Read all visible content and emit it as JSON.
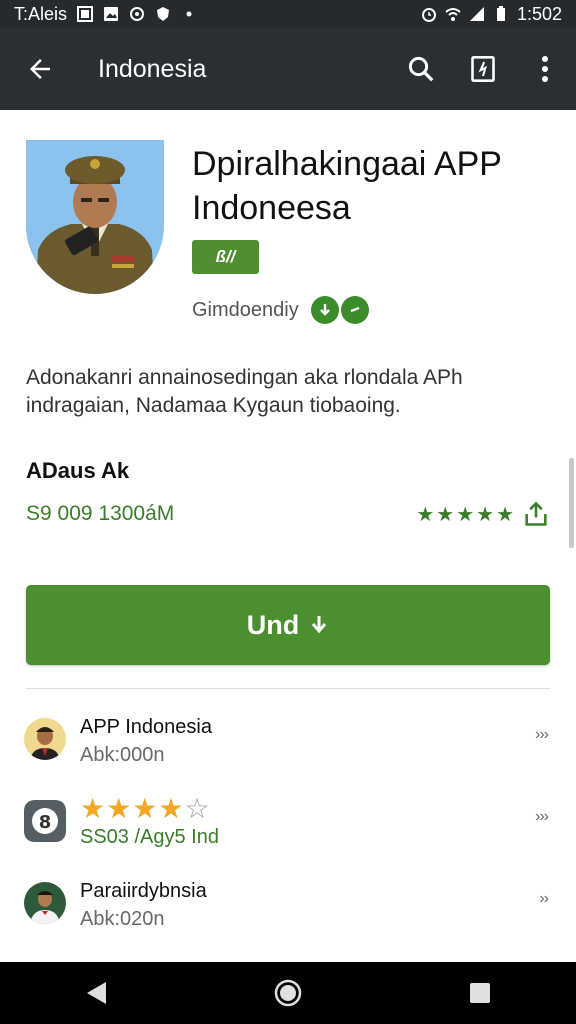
{
  "status_bar": {
    "carrier": "T:Aleis",
    "time": "1:502"
  },
  "app_bar": {
    "title": "Indonesia",
    "back_icon": "arrow-left-icon",
    "actions": [
      "search-icon",
      "bookmark-icon",
      "more-vert-icon"
    ]
  },
  "app": {
    "title": "Dpiralhakingaai APP Indoneesa",
    "badge": "ß//",
    "developer": "Gimdoendiy",
    "description": "Adonakanri annainosedingan aka rlondala APh indragaian, Nadamaa  Kygaun tiobaoing.",
    "size_label": "ADaus Ak",
    "meta": "S9 009  1300áM",
    "rating_stars": 5
  },
  "install_button": {
    "label": "Und",
    "icon": "download-arrow-icon"
  },
  "list": [
    {
      "title": "APP Indonesia",
      "subtitle": "Abk:000n",
      "chevron": "›››"
    },
    {
      "stars_filled": 4,
      "stars_total": 5,
      "subtitle": "SS03 /Agy5 Ind",
      "chevron": "›››"
    },
    {
      "title": "Paraiirdybnsia",
      "subtitle": "Abk:020n",
      "chevron": "››"
    }
  ],
  "colors": {
    "app_bar": "#2a2f31",
    "status_bar": "#262a2c",
    "accent_green": "#4b8f2f",
    "star_gold": "#f5a623"
  }
}
